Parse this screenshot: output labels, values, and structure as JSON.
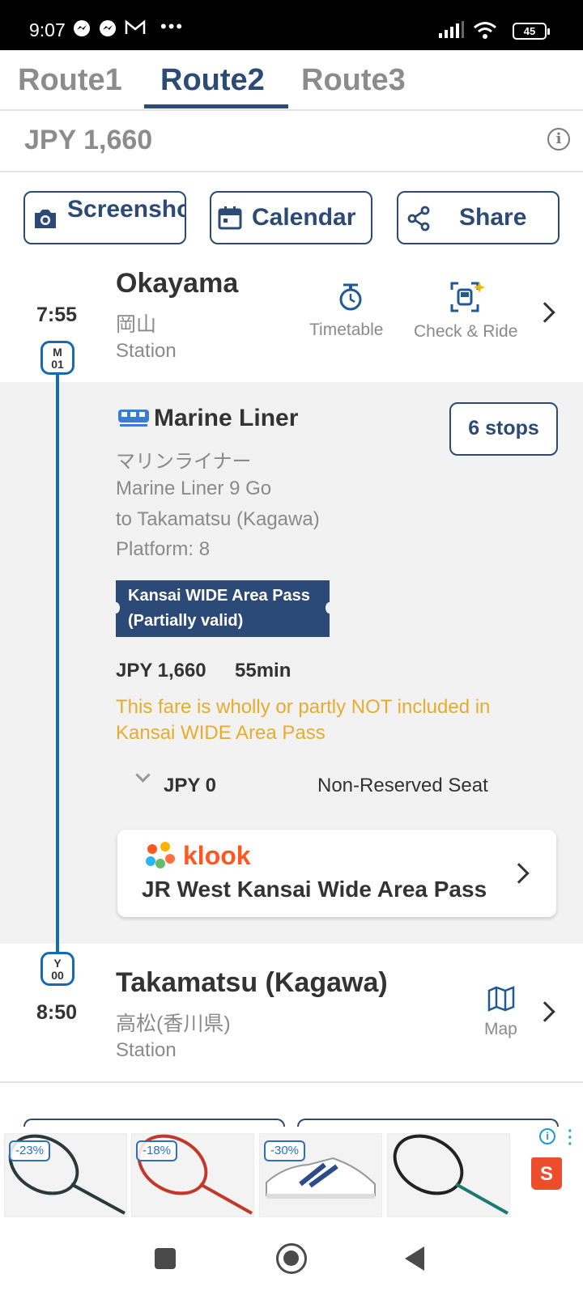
{
  "status_bar": {
    "time": "9:07",
    "battery": "45"
  },
  "tabs": [
    {
      "label": "Route1"
    },
    {
      "label": "Route2",
      "active": true
    },
    {
      "label": "Route3"
    }
  ],
  "fare_total": "JPY 1,660",
  "info_symbol": "i",
  "action_buttons": {
    "screenshot": "Screenshot",
    "calendar": "Calendar",
    "share": "Share"
  },
  "origin": {
    "time": "7:55",
    "name": "Okayama",
    "name_jp": "岡山",
    "type": "Station",
    "code_line": "M",
    "code_num": "01",
    "timetable_label": "Timetable",
    "check_ride_label": "Check & Ride"
  },
  "ride": {
    "train_name": "Marine Liner",
    "train_name_jp": "マリンライナー",
    "service": "Marine Liner 9 Go",
    "direction": "to Takamatsu (Kagawa)",
    "platform": "Platform: 8",
    "stops": "6 stops",
    "pass_line1": "Kansai WIDE Area Pass",
    "pass_line2": "(Partially valid)",
    "fare": "JPY 1,660",
    "duration": "55min",
    "warning_line1": "This fare is wholly or partly NOT included in",
    "warning_line2": "Kansai WIDE Area Pass",
    "seat_fare": "JPY 0",
    "seat_type": "Non-Reserved Seat"
  },
  "klook": {
    "brand": "klook",
    "product": "JR West Kansai Wide Area Pass"
  },
  "destination": {
    "time": "8:50",
    "name": "Takamatsu (Kagawa)",
    "name_jp": "高松(香川県)",
    "type": "Station",
    "code_line": "Y",
    "code_num": "00",
    "map_label": "Map"
  },
  "ads": {
    "badges": [
      "-23%",
      "-18%",
      "-30%"
    ],
    "shop_letter": "S"
  },
  "colors": {
    "accent": "#2b4a75",
    "route_line": "#1769b5",
    "warning": "#e6ac2d",
    "klook_orange": "#ff5722"
  }
}
